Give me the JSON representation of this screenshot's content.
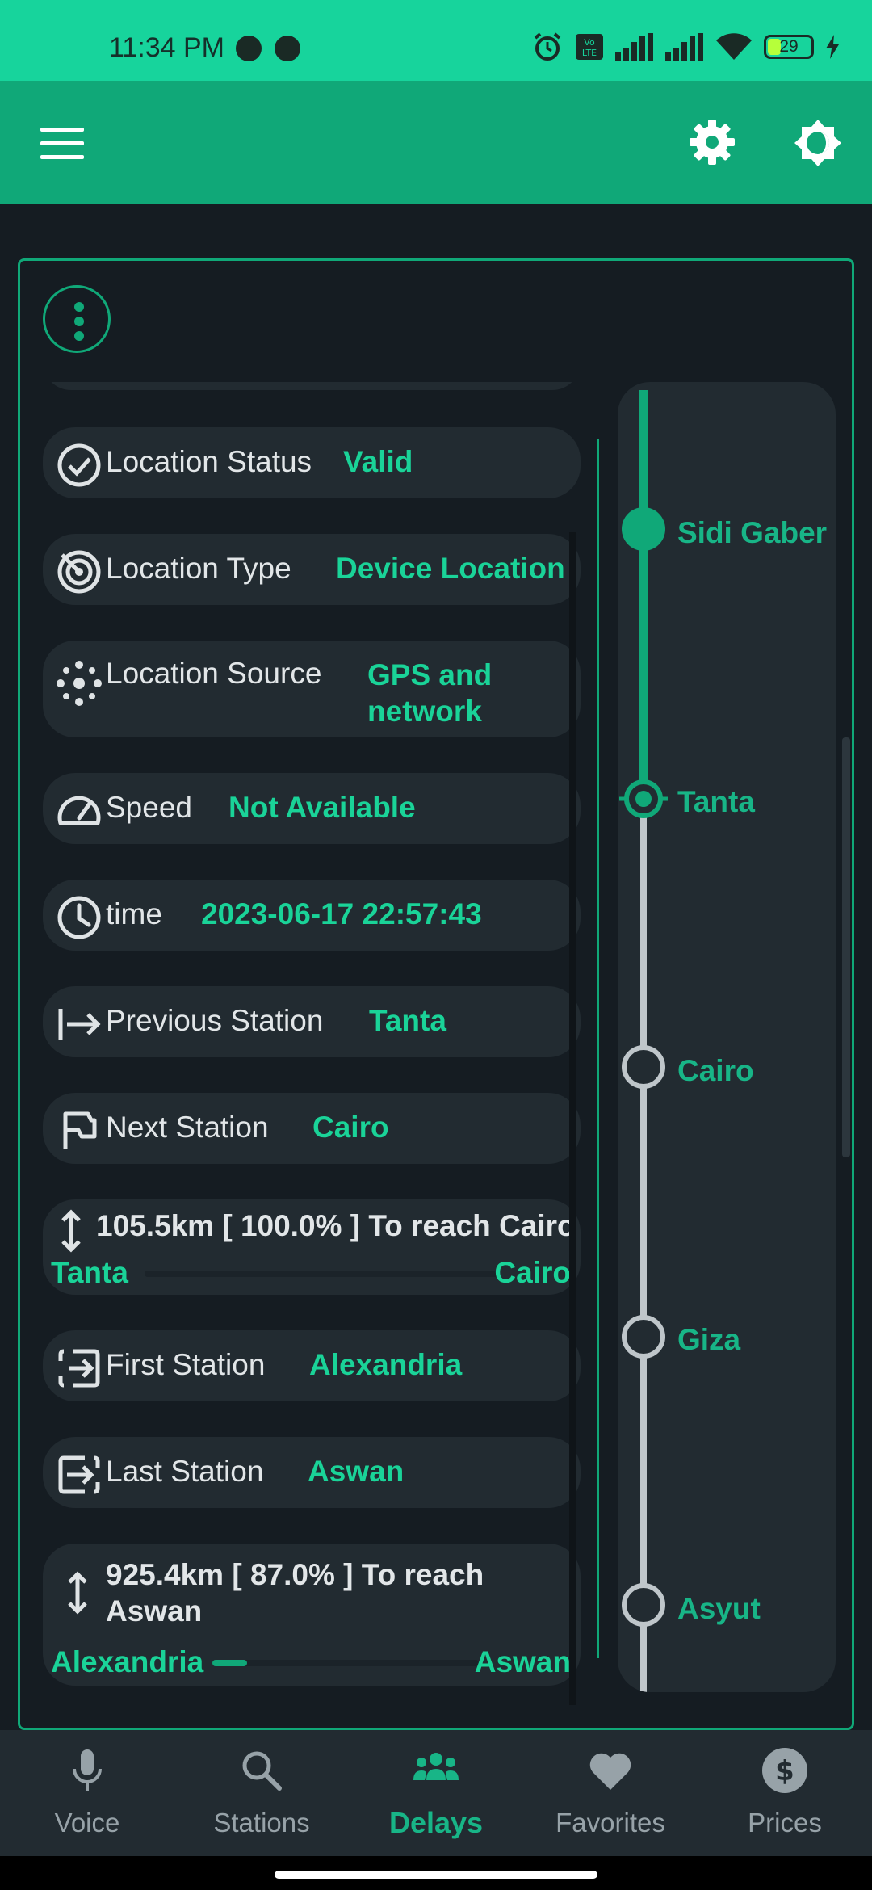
{
  "status_bar": {
    "time": "11:34 PM",
    "battery": "29",
    "battery_level": 0.29
  },
  "card": {
    "info": [
      {
        "icon": "check-circle-icon",
        "label": "Location Status",
        "value": "Valid"
      },
      {
        "icon": "target-icon",
        "label": "Location Type",
        "value": "Device Location"
      },
      {
        "icon": "gps-dots-icon",
        "label": "Location Source",
        "value": "GPS and network"
      },
      {
        "icon": "speedometer-icon",
        "label": "Speed",
        "value": "Not Available"
      },
      {
        "icon": "clock-icon",
        "label": "time",
        "value": "2023-06-17 22:57:43"
      },
      {
        "icon": "arrow-right-bar-icon",
        "label": "Previous Station",
        "value": "Tanta"
      },
      {
        "icon": "flag-icon",
        "label": "Next Station",
        "value": "Cairo"
      },
      {
        "icon": "login-icon",
        "label": "First Station",
        "value": "Alexandria"
      },
      {
        "icon": "logout-icon",
        "label": "Last Station",
        "value": "Aswan"
      }
    ],
    "progress_next": {
      "title": "105.5km [ 100.0% ] To reach Cairo",
      "from": "Tanta",
      "to": "Cairo",
      "fraction": 0.0
    },
    "progress_total": {
      "title": "925.4km [ 87.0% ] To reach Aswan",
      "from": "Alexandria",
      "to": "Aswan",
      "fraction": 0.13
    }
  },
  "timeline": {
    "stations": [
      {
        "name": "Sidi Gaber",
        "state": "passed"
      },
      {
        "name": "Tanta",
        "state": "current"
      },
      {
        "name": "Cairo",
        "state": "upcoming"
      },
      {
        "name": "Giza",
        "state": "upcoming"
      },
      {
        "name": "Asyut",
        "state": "upcoming"
      }
    ]
  },
  "bottom_nav": [
    {
      "label": "Voice",
      "icon": "microphone-icon",
      "active": false
    },
    {
      "label": "Stations",
      "icon": "search-icon",
      "active": false
    },
    {
      "label": "Delays",
      "icon": "group-icon",
      "active": true
    },
    {
      "label": "Favorites",
      "icon": "heart-icon",
      "active": false
    },
    {
      "label": "Prices",
      "icon": "dollar-circle-icon",
      "active": false
    }
  ],
  "colors": {
    "accent": "#17d49c",
    "appbar": "#10a878",
    "background": "#151c22",
    "pill": "#222b31",
    "value": "#1ad398"
  }
}
